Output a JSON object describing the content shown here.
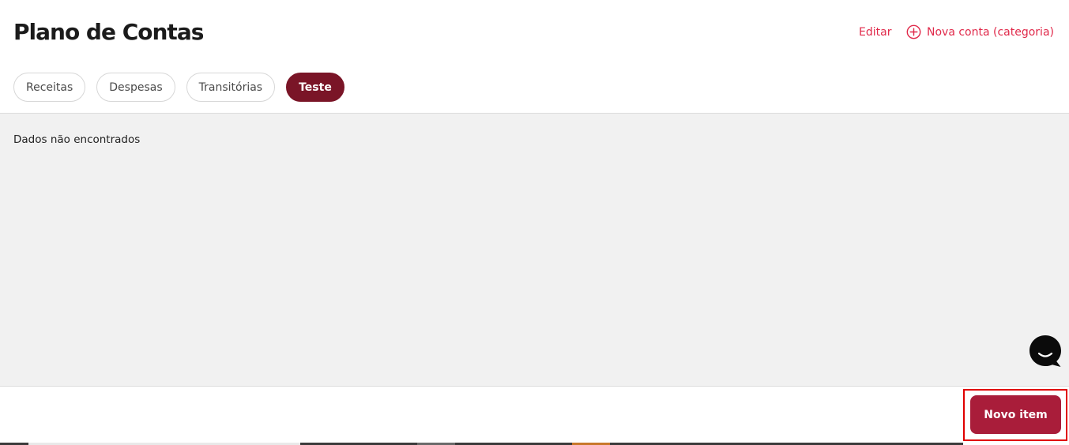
{
  "header": {
    "title": "Plano de Contas",
    "edit_label": "Editar",
    "new_account_label": "Nova conta (categoria)"
  },
  "tabs": [
    {
      "label": "Receitas",
      "active": false
    },
    {
      "label": "Despesas",
      "active": false
    },
    {
      "label": "Transitórias",
      "active": false
    },
    {
      "label": "Teste",
      "active": true
    }
  ],
  "content": {
    "empty_message": "Dados não encontrados"
  },
  "footer": {
    "new_item_label": "Novo item"
  },
  "icons": {
    "new_account": "plus-circle-icon",
    "chat": "chat-bubble-icon"
  },
  "colors": {
    "accent": "#e0294a",
    "active_tab": "#7a1527",
    "primary_button": "#a91d3a",
    "content_background": "#f1f1f1",
    "highlight": "#e00000"
  }
}
